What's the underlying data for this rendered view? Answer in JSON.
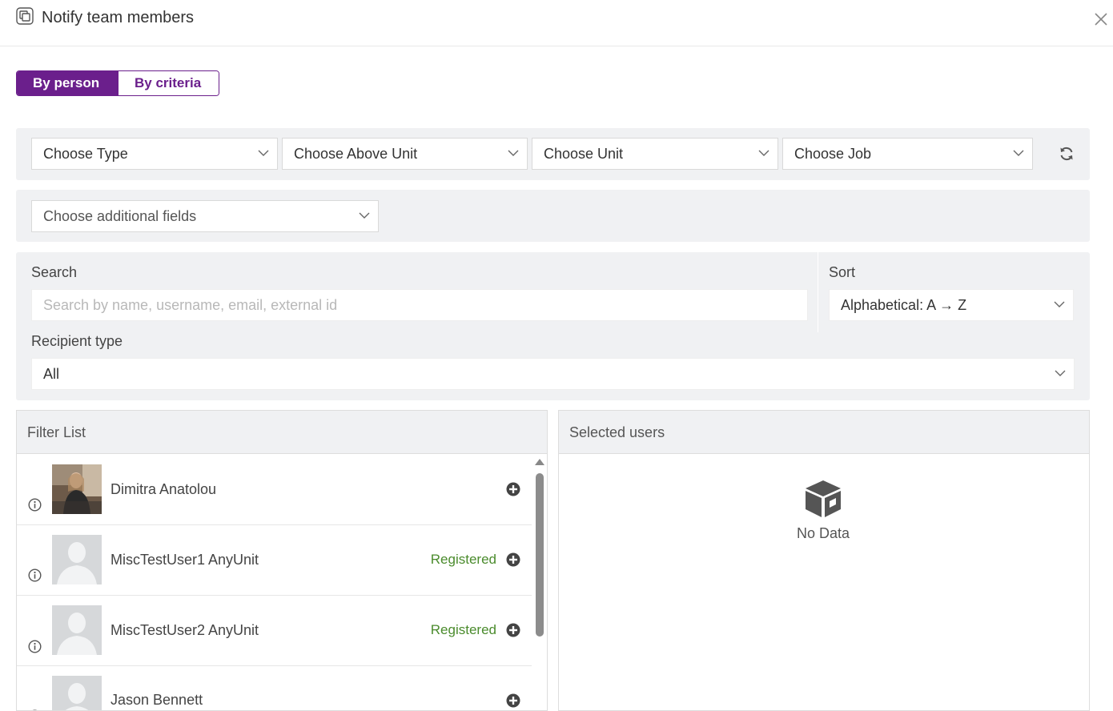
{
  "header": {
    "title": "Notify team members",
    "window_icon": "copy-window-icon",
    "close_icon": "close-icon"
  },
  "mode_toggle": {
    "by_person": "By person",
    "by_criteria": "By criteria",
    "active": "by_person"
  },
  "filters": {
    "type_placeholder": "Choose Type",
    "above_unit_placeholder": "Choose Above Unit",
    "unit_placeholder": "Choose Unit",
    "job_placeholder": "Choose Job",
    "additional_fields_placeholder": "Choose additional fields"
  },
  "search": {
    "label": "Search",
    "placeholder": "Search by name, username, email, external id",
    "value": ""
  },
  "sort": {
    "label": "Sort",
    "value": "Alphabetical: A → Z"
  },
  "recipient_type": {
    "label": "Recipient type",
    "value": "All"
  },
  "filter_list": {
    "title": "Filter List",
    "users": [
      {
        "name": "Dimitra Anatolou",
        "status": "",
        "avatar": "photo"
      },
      {
        "name": "MiscTestUser1 AnyUnit",
        "status": "Registered",
        "avatar": "placeholder"
      },
      {
        "name": "MiscTestUser2 AnyUnit",
        "status": "Registered",
        "avatar": "placeholder"
      },
      {
        "name": "Jason Bennett",
        "status": "",
        "avatar": "placeholder"
      }
    ]
  },
  "selected_users": {
    "title": "Selected users",
    "empty_text": "No Data"
  },
  "colors": {
    "accent": "#6b1f8c",
    "registered": "#4a8b2c",
    "panel_bg": "#f0f1f3"
  }
}
